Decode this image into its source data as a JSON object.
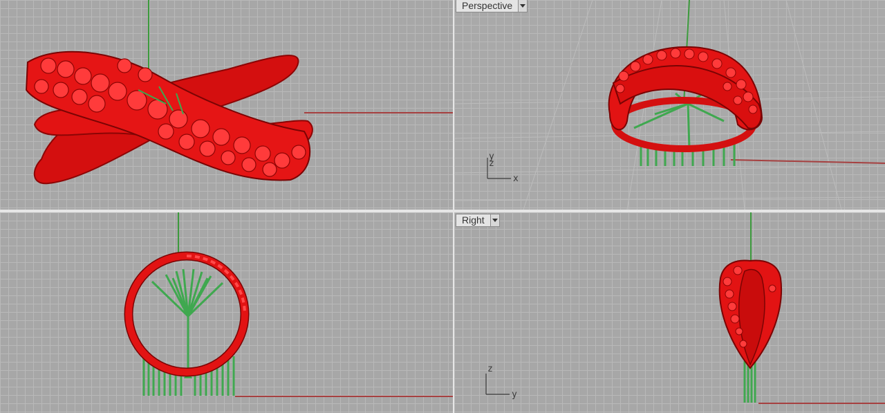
{
  "viewports": {
    "perspective": {
      "label": "Perspective",
      "axis_x": "x",
      "axis_y": "y",
      "axis_z": "z"
    },
    "right": {
      "label": "Right",
      "axis_vertical": "z",
      "axis_horizontal": "y"
    },
    "front": {},
    "top": {}
  },
  "colors": {
    "viewport_bg": "#a7a7a7",
    "grid_line": "#b9b9b9",
    "ring_red": "#e01010",
    "support_green": "#3fa84f",
    "x_axis_red": "#a64040",
    "y_axis_green": "#3c9a3c"
  }
}
